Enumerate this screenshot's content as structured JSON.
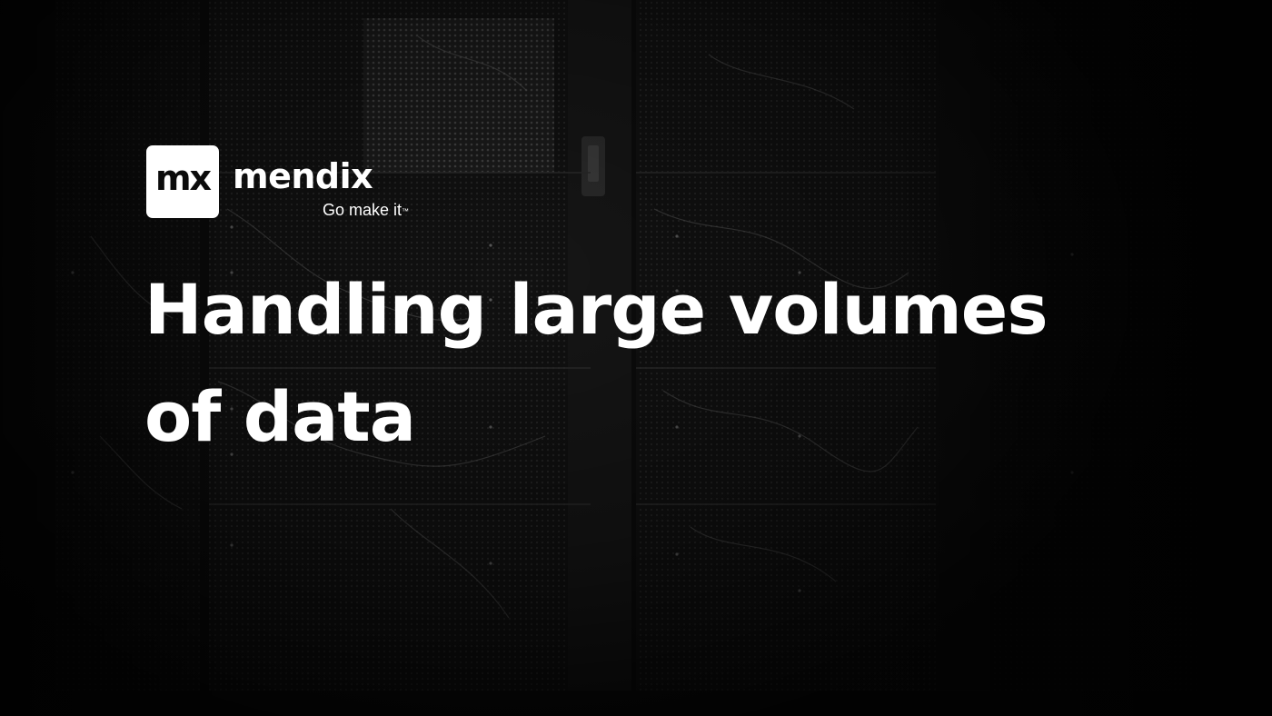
{
  "brand": {
    "badge": "mx",
    "name": "mendix",
    "tagline": "Go make it",
    "trademark": "™"
  },
  "headline": {
    "line1": "Handling large volumes",
    "line2": "of data"
  },
  "colors": {
    "text": "#ffffff",
    "background": "#0d0d0d",
    "badge_background": "#ffffff",
    "badge_text": "#0b0b0b"
  },
  "icons": {
    "background": "server-rack-photo"
  }
}
